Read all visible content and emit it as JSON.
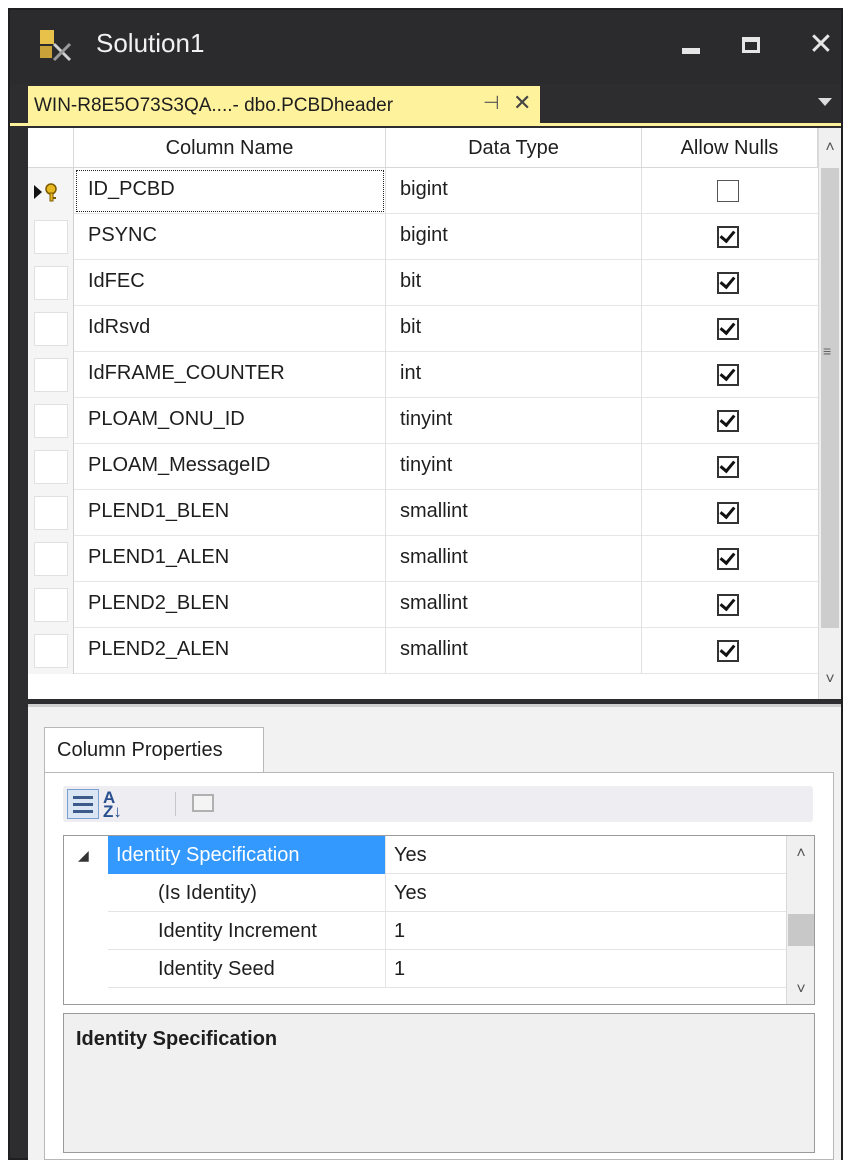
{
  "window": {
    "title": "Solution1"
  },
  "tab": {
    "label": "WIN-R8E5O73S3QA....- dbo.PCBDheader",
    "pin_glyph": "⊣",
    "close_glyph": "✕"
  },
  "grid": {
    "headers": {
      "column_name": "Column Name",
      "data_type": "Data Type",
      "allow_nulls": "Allow Nulls"
    },
    "rows": [
      {
        "name": "ID_PCBD",
        "type": "bigint",
        "allow_nulls": false,
        "primary_key": true
      },
      {
        "name": "PSYNC",
        "type": "bigint",
        "allow_nulls": true
      },
      {
        "name": "IdFEC",
        "type": "bit",
        "allow_nulls": true
      },
      {
        "name": "IdRsvd",
        "type": "bit",
        "allow_nulls": true
      },
      {
        "name": "IdFRAME_COUNTER",
        "type": "int",
        "allow_nulls": true
      },
      {
        "name": "PLOAM_ONU_ID",
        "type": "tinyint",
        "allow_nulls": true
      },
      {
        "name": "PLOAM_MessageID",
        "type": "tinyint",
        "allow_nulls": true
      },
      {
        "name": "PLEND1_BLEN",
        "type": "smallint",
        "allow_nulls": true
      },
      {
        "name": "PLEND1_ALEN",
        "type": "smallint",
        "allow_nulls": true
      },
      {
        "name": "PLEND2_BLEN",
        "type": "smallint",
        "allow_nulls": true
      },
      {
        "name": "PLEND2_ALEN",
        "type": "smallint",
        "allow_nulls": true
      }
    ]
  },
  "properties": {
    "tab_label": "Column Properties",
    "toolbar": {
      "categorized_icon": "categorized-icon",
      "alphabetical_icon": "sort-az-icon",
      "property_pages_icon": "property-pages-icon"
    },
    "rows": [
      {
        "name": "Identity Specification",
        "value": "Yes",
        "expanded": true,
        "selected": true
      },
      {
        "name": "(Is Identity)",
        "value": "Yes"
      },
      {
        "name": "Identity Increment",
        "value": "1"
      },
      {
        "name": "Identity Seed",
        "value": "1"
      }
    ],
    "description_title": "Identity Specification"
  },
  "colors": {
    "tab_accent": "#fff29d",
    "selection": "#3399ff",
    "chrome": "#2d2d30"
  }
}
